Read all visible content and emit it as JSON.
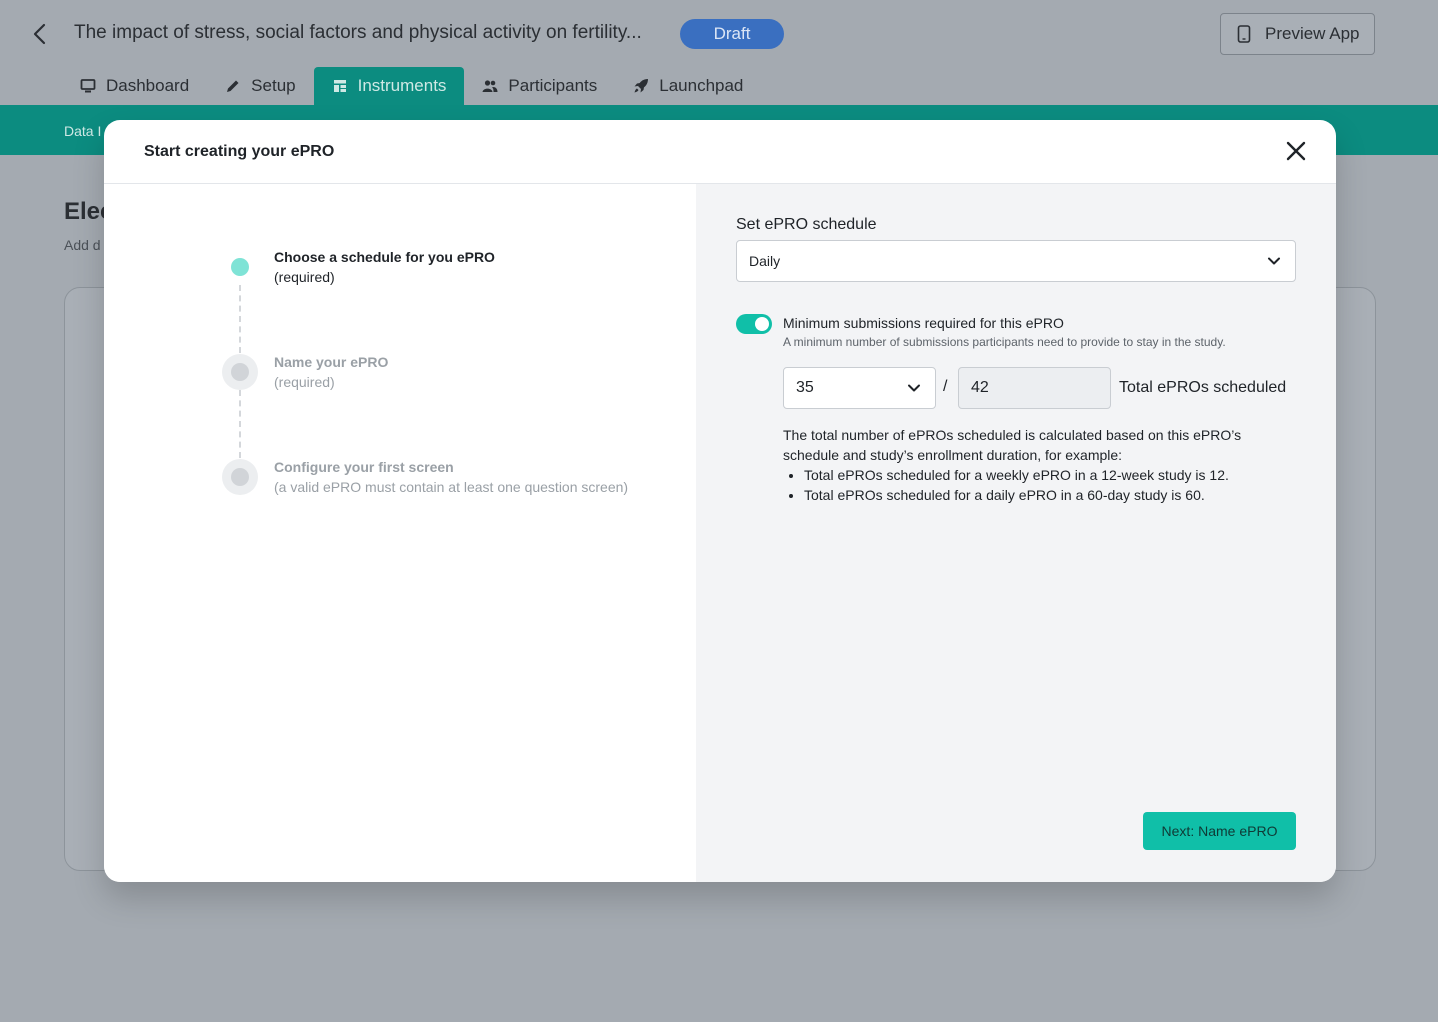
{
  "header": {
    "study_title": "The impact of stress, social factors and physical activity on fertility...",
    "status_badge": "Draft",
    "preview_label": "Preview App"
  },
  "nav": {
    "tabs": [
      {
        "label": "Dashboard",
        "icon": "monitor-icon"
      },
      {
        "label": "Setup",
        "icon": "pencil-icon"
      },
      {
        "label": "Instruments",
        "icon": "instruments-icon",
        "active": true
      },
      {
        "label": "Participants",
        "icon": "users-icon"
      },
      {
        "label": "Launchpad",
        "icon": "rocket-icon"
      }
    ]
  },
  "background": {
    "band_text": "Data I",
    "heading": "Elec",
    "subtext": "Add d"
  },
  "modal": {
    "title": "Start creating your ePRO",
    "steps": [
      {
        "title": "Choose a schedule for you ePRO",
        "sub": "(required)",
        "state": "active"
      },
      {
        "title": "Name your ePRO",
        "sub": "(required)",
        "state": "pending"
      },
      {
        "title": "Configure your first screen",
        "sub": "(a valid ePRO must contain at least one question screen)",
        "state": "pending"
      }
    ],
    "schedule": {
      "label": "Set ePRO schedule",
      "value": "Daily"
    },
    "minimum": {
      "enabled": true,
      "label": "Minimum submissions required for this ePRO",
      "help": "A minimum number of submissions participants need to provide to stay in the study.",
      "value": "35",
      "separator": "/",
      "total": "42",
      "total_label": "Total ePROs scheduled"
    },
    "explanation": {
      "intro": "The total number of ePROs scheduled is calculated based on this ePRO’s schedule and study’s enrollment duration, for example:",
      "examples": [
        "Total ePROs scheduled for a weekly ePRO in a 12-week study is 12.",
        "Total ePROs scheduled for a daily ePRO in a 60-day study is 60."
      ]
    },
    "next_label": "Next: Name ePRO"
  },
  "colors": {
    "teal": "#0c8c80",
    "accent": "#10bfa8",
    "draft": "#3a6fc0"
  }
}
